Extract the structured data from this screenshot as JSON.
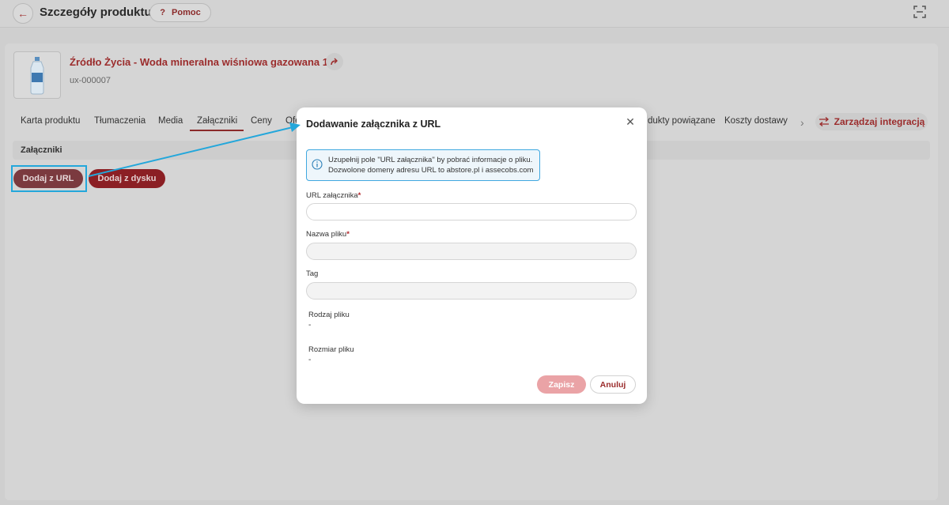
{
  "header": {
    "title": "Szczegóły produktu",
    "help_label": "Pomoc",
    "help_icon": "?"
  },
  "product": {
    "name": "Źródło Życia - Woda mineralna wiśniowa gazowana 1,5l",
    "code": "ux-000007"
  },
  "tabs": [
    {
      "label": "Karta produktu"
    },
    {
      "label": "Tłumaczenia"
    },
    {
      "label": "Media"
    },
    {
      "label": "Załączniki",
      "active": true
    },
    {
      "label": "Ceny"
    },
    {
      "label": "Ofe"
    },
    {
      "label": "dukty powiązane"
    },
    {
      "label": "Koszty dostawy"
    }
  ],
  "manage_integration_label": "Zarządzaj integracją",
  "section": {
    "title": "Załączniki",
    "add_url_label": "Dodaj z URL",
    "add_disk_label": "Dodaj z dysku"
  },
  "modal": {
    "title": "Dodawanie załącznika z URL",
    "info_line1": "Uzupełnij pole \"URL załącznika\" by pobrać informacje o pliku.",
    "info_line2": "Dozwolone domeny adresu URL to abstore.pl i assecobs.com",
    "fields": {
      "url_label": "URL załącznika",
      "filename_label": "Nazwa pliku",
      "tag_label": "Tag",
      "required_mark": "*"
    },
    "meta": {
      "type_label": "Rodzaj pliku",
      "type_value": "-",
      "size_label": "Rozmiar pliku",
      "size_value": "-"
    },
    "save_label": "Zapisz",
    "cancel_label": "Anuluj"
  },
  "colors": {
    "brand": "#9b2c2c",
    "annotation": "#23a7db"
  }
}
